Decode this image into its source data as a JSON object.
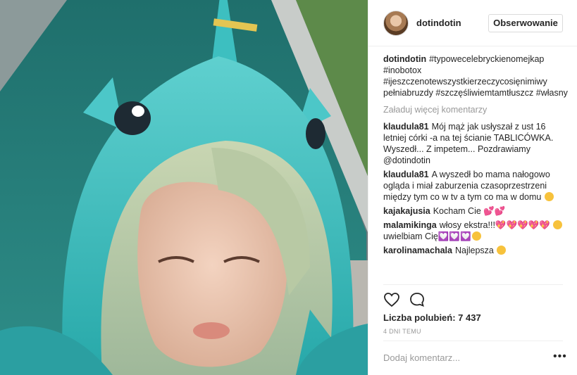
{
  "post": {
    "image_alt": "",
    "author": "dotindotin",
    "follow_label": "Obserwowanie",
    "caption": {
      "user": "dotindotin",
      "text": "#typowecelebryckienomejkap #inobotox #ijeszczenotewszystkierzeczycosięnimiwy pełniabruzdy #szczęśliwiemtamtłuszcz #własny"
    },
    "load_more": "Załaduj więcej komentarzy",
    "comments": [
      {
        "user": "klaudula81",
        "text": "Mój mąż jak usłyszał z ust 16 letniej córki -a na tej ścianie TABLICÓWKA. Wyszedł... Z impetem... Pozdrawiamy @dotindotin"
      },
      {
        "user": "klaudula81",
        "text": "A wyszedł bo mama nałogowo ogląda i miał zaburzenia czasoprzestrzeni między tym co w tv a tym co ma w domu"
      },
      {
        "user": "kajakajusia",
        "text": "Kocham Cie",
        "hearts": "💕💕"
      },
      {
        "user": "malamikinga",
        "text": "włosy ekstra!!!",
        "hearts": "💖💖💖💖💖",
        "text2": "uwielbiam Cię",
        "hearts2": "💟💟💟"
      },
      {
        "user": "karolinamachala",
        "text": "Najlepsza"
      }
    ],
    "likes_label": "Liczba polubień: 7 437",
    "timestamp": "4 DNI TEMU",
    "add_comment_placeholder": "Dodaj komentarz...",
    "more_label": "•••"
  },
  "icons": {
    "like": "heart-icon",
    "comment": "comment-bubble-icon",
    "more": "more-options-icon"
  },
  "colors": {
    "hashtag": "#003569",
    "muted": "#999999",
    "text": "#262626",
    "border": "#dbdbdb",
    "hearts": "#e64fb5"
  }
}
